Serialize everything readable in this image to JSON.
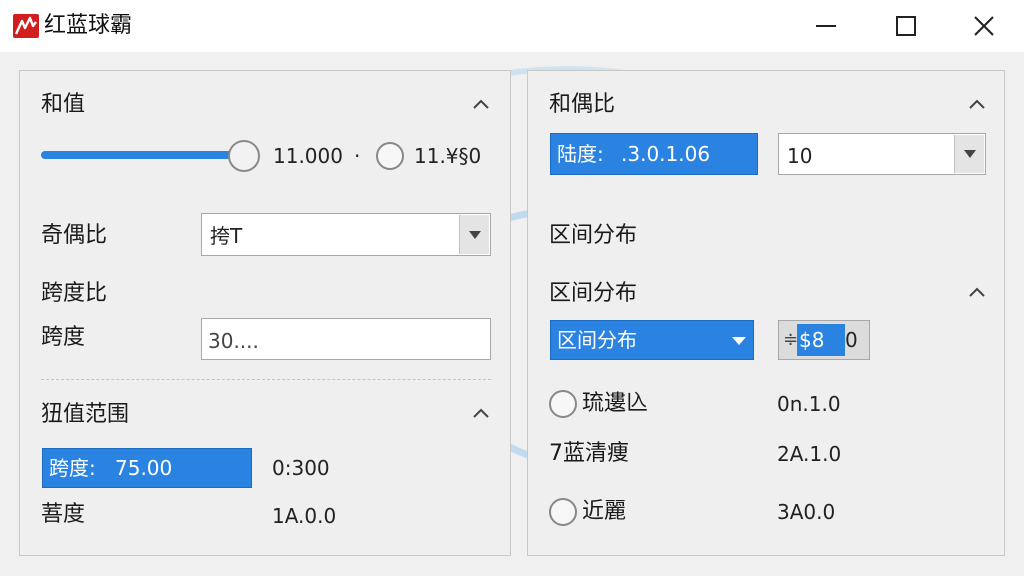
{
  "window": {
    "title": "红蓝球霸",
    "icon": "app-logo-icon",
    "accent_color": "#2a83e0",
    "brand_color": "#d11f1f"
  },
  "left_panel": {
    "sum": {
      "title": "和值",
      "slider_value": "11.000",
      "separator": "·",
      "radio_value": "11.¥§0"
    },
    "odd_even": {
      "label": "奇偶比",
      "select_value": "挎T"
    },
    "span_ratio": {
      "label": "跨度比"
    },
    "span": {
      "label": "跨度",
      "input_placeholder": "30...."
    },
    "range": {
      "title": "狃值范围",
      "field_label": "跨度:",
      "field_value": "75.00",
      "field_range": "0:300",
      "row_label": "䓊度",
      "row_value": "1A.0.0"
    }
  },
  "right_panel": {
    "odd_even_ratio": {
      "title": "和偶比",
      "span_field_label": "陆度:",
      "span_field_value": ".3.0.1.06",
      "select_value": "10"
    },
    "dist_label": "区间分布",
    "dist": {
      "title": "区间分布",
      "select_value": "区间分布",
      "spin_glyph": "≑",
      "spin_selected": "$8",
      "spin_rest": "0"
    },
    "options": [
      {
        "label": "琉遱兦",
        "value": "0n.1.0",
        "has_radio": true
      },
      {
        "label": "7蓝清痩",
        "value": "2A.1.0",
        "has_radio": false
      },
      {
        "label": "近麗",
        "value": "3A0.0",
        "has_radio": true
      }
    ]
  }
}
